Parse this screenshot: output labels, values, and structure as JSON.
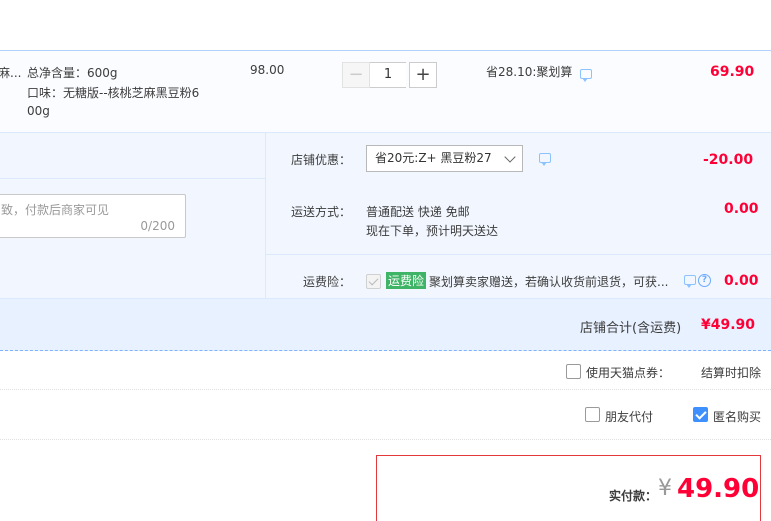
{
  "item": {
    "name_fragment": "麻...",
    "spec_weight": "总净含量：600g",
    "spec_flavor_line1": "口味：无糖版--核桃芝麻黑豆粉6",
    "spec_flavor_line2": "00g",
    "unit_price": "98.00",
    "quantity": "1",
    "minus_label": "−",
    "plus_label": "+",
    "discount_text": "省28.10:聚划算",
    "subtotal": "69.90"
  },
  "promo": {
    "shop_discount_label": "店铺优惠：",
    "shop_discount_selected": "省20元:Z+ 黑豆粉27",
    "shop_discount_amount": "-20.00",
    "shipping_label": "运送方式：",
    "shipping_line1": "普通配送 快递 免邮",
    "shipping_line2": "现在下单，预计明天送达",
    "shipping_amount": "0.00",
    "insurance_label": "运费险：",
    "insurance_tag": "运费险",
    "insurance_text": "聚划算卖家赠送，若确认收货前退货，可获...",
    "insurance_amount": "0.00",
    "message_placeholder": "致，付款后商家可见",
    "message_counter": "0/200"
  },
  "total": {
    "label": "店铺合计(含运费)",
    "value": "¥49.90"
  },
  "points": {
    "label": "使用天猫点券：",
    "note": "结算时扣除"
  },
  "options": {
    "friend_pay_label": "朋友代付",
    "anonymous_label": "匿名购买"
  },
  "payment": {
    "label": "实付款：",
    "currency": "¥",
    "amount": "49.90"
  },
  "colors": {
    "accent_red": "#ff0036",
    "accent_blue": "#3f90ff",
    "tag_green": "#3fb466"
  }
}
